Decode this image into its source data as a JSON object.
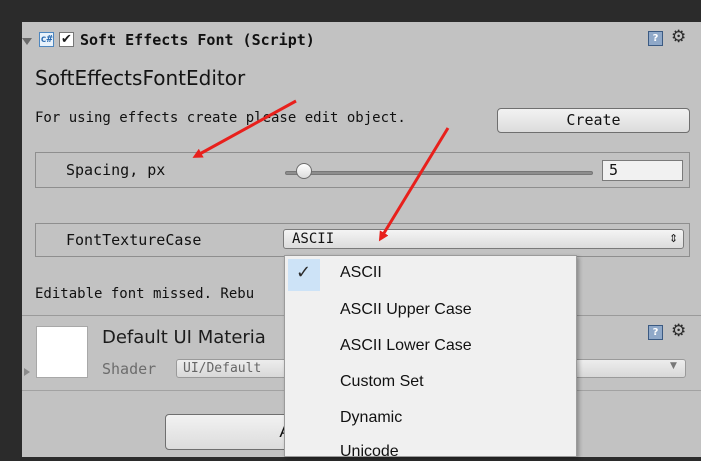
{
  "component": {
    "title": "Soft Effects Font (Script)",
    "enabled_check": "✔",
    "script_icon": "c#-script-icon",
    "help_icon": "?",
    "gear_icon": "⚙",
    "editor_title": "SoftEffectsFontEditor",
    "info_text": "For using effects create please edit object.",
    "create_button": "Create"
  },
  "spacing": {
    "label": "Spacing, px",
    "value": "5",
    "slider_fraction": 0.05
  },
  "font_texture_case": {
    "label": "FontTextureCase",
    "selected": "ASCII",
    "arrow": "⇕"
  },
  "warning_text": "Editable font missed. Rebu",
  "material": {
    "title": "Default UI Materia",
    "shader_label": "Shader",
    "shader_value": "UI/Default",
    "help_icon": "?",
    "gear_icon": "⚙"
  },
  "bottom_button": "A",
  "dropdown": {
    "check": "✓",
    "items": [
      "ASCII",
      "ASCII Upper Case",
      "ASCII Lower Case",
      "Custom Set",
      "Dynamic",
      "Unicode"
    ]
  },
  "colors": {
    "panel_bg": "#c2c2c2",
    "frame_bg": "#2b2b2b",
    "arrow_red": "#e8201c",
    "selected_highlight": "#cde3f7"
  }
}
